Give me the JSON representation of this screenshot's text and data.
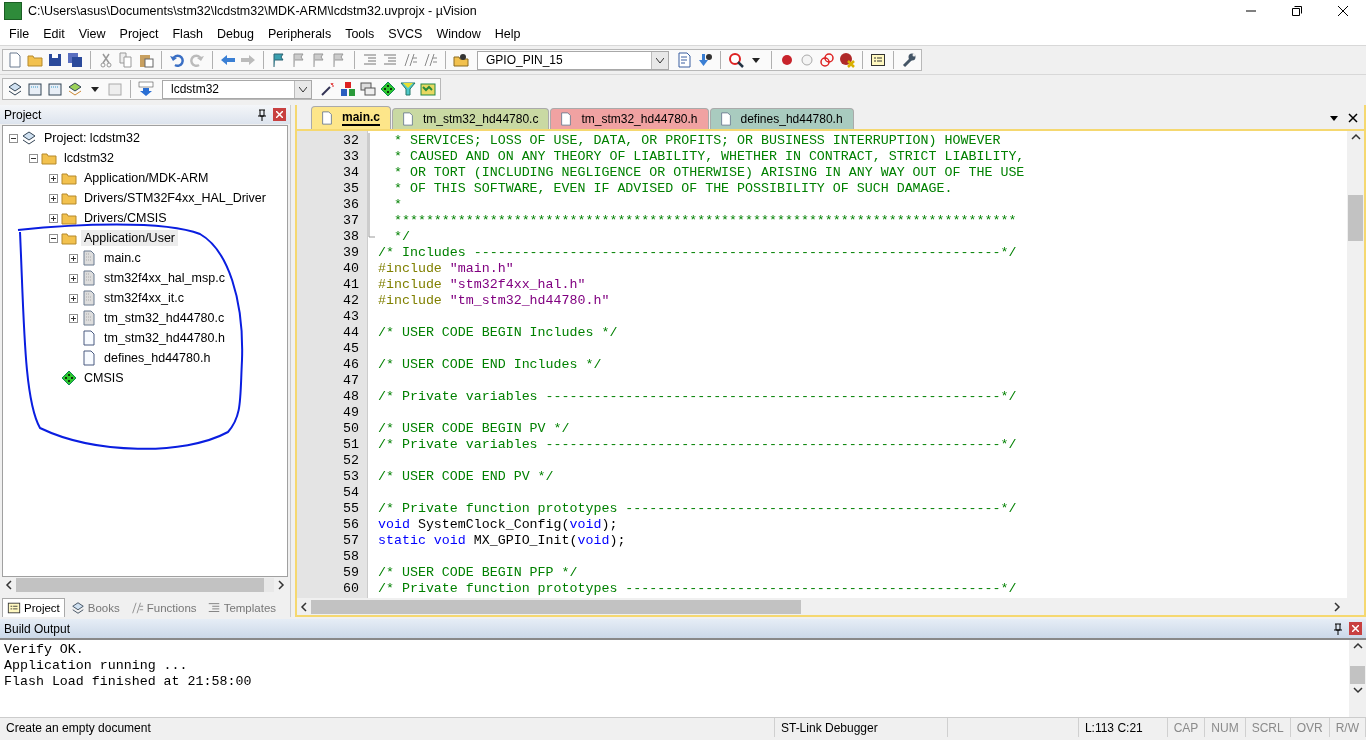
{
  "window": {
    "title": "C:\\Users\\asus\\Documents\\stm32\\lcdstm32\\MDK-ARM\\lcdstm32.uvprojx - µVision"
  },
  "menu": [
    "File",
    "Edit",
    "View",
    "Project",
    "Flash",
    "Debug",
    "Peripherals",
    "Tools",
    "SVCS",
    "Window",
    "Help"
  ],
  "toolbar": {
    "find_value": "GPIO_PIN_15",
    "target_value": "lcdstm32"
  },
  "project_panel": {
    "title": "Project",
    "tree": [
      {
        "label": "Project: lcdstm32",
        "kind": "project",
        "expanded": true,
        "selected": false,
        "children": [
          {
            "label": "lcdstm32",
            "kind": "target",
            "expanded": true,
            "selected": false,
            "children": [
              {
                "label": "Application/MDK-ARM",
                "kind": "folder",
                "expanded": false,
                "selected": false
              },
              {
                "label": "Drivers/STM32F4xx_HAL_Driver",
                "kind": "folder",
                "expanded": false,
                "selected": false
              },
              {
                "label": "Drivers/CMSIS",
                "kind": "folder",
                "expanded": false,
                "selected": false
              },
              {
                "label": "Application/User",
                "kind": "folder",
                "expanded": true,
                "selected": true,
                "children": [
                  {
                    "label": "main.c",
                    "kind": "source",
                    "expanded": false,
                    "selected": false
                  },
                  {
                    "label": "stm32f4xx_hal_msp.c",
                    "kind": "source",
                    "expanded": false,
                    "selected": false
                  },
                  {
                    "label": "stm32f4xx_it.c",
                    "kind": "source",
                    "expanded": false,
                    "selected": false
                  },
                  {
                    "label": "tm_stm32_hd44780.c",
                    "kind": "source",
                    "expanded": false,
                    "selected": false
                  },
                  {
                    "label": "tm_stm32_hd44780.h",
                    "kind": "header",
                    "selected": false
                  },
                  {
                    "label": "defines_hd44780.h",
                    "kind": "header",
                    "selected": false
                  }
                ]
              },
              {
                "label": "CMSIS",
                "kind": "component",
                "selected": false
              }
            ]
          }
        ]
      }
    ],
    "tabs": [
      {
        "label": "Project",
        "selected": true
      },
      {
        "label": "Books",
        "selected": false
      },
      {
        "label": "Functions",
        "selected": false
      },
      {
        "label": "Templates",
        "selected": false
      }
    ]
  },
  "editor": {
    "tabs": [
      {
        "label": "main.c",
        "selected": true,
        "color": "#fde68a"
      },
      {
        "label": "tm_stm32_hd44780.c",
        "selected": false,
        "color": "#c9d9a3"
      },
      {
        "label": "tm_stm32_hd44780.h",
        "selected": false,
        "color": "#f0a2a2"
      },
      {
        "label": "defines_hd44780.h",
        "selected": false,
        "color": "#a9cbbf"
      }
    ],
    "lines": [
      {
        "number": "32",
        "parts": [
          {
            "kind": "comment",
            "text": "  * SERVICES; LOSS OF USE, DATA, OR PROFITS; OR BUSINESS INTERRUPTION) HOWEVER"
          }
        ]
      },
      {
        "number": "33",
        "parts": [
          {
            "kind": "comment",
            "text": "  * CAUSED AND ON ANY THEORY OF LIABILITY, WHETHER IN CONTRACT, STRICT LIABILITY,"
          }
        ]
      },
      {
        "number": "34",
        "parts": [
          {
            "kind": "comment",
            "text": "  * OR TORT (INCLUDING NEGLIGENCE OR OTHERWISE) ARISING IN ANY WAY OUT OF THE USE"
          }
        ]
      },
      {
        "number": "35",
        "parts": [
          {
            "kind": "comment",
            "text": "  * OF THIS SOFTWARE, EVEN IF ADVISED OF THE POSSIBILITY OF SUCH DAMAGE."
          }
        ]
      },
      {
        "number": "36",
        "parts": [
          {
            "kind": "comment",
            "text": "  *"
          }
        ]
      },
      {
        "number": "37",
        "parts": [
          {
            "kind": "comment",
            "text": "  ******************************************************************************"
          }
        ]
      },
      {
        "number": "38",
        "parts": [
          {
            "kind": "comment",
            "text": "  */"
          }
        ]
      },
      {
        "number": "39",
        "parts": [
          {
            "kind": "comment",
            "text": "/* Includes ------------------------------------------------------------------*/"
          }
        ]
      },
      {
        "number": "40",
        "parts": [
          {
            "kind": "preprocessor",
            "text": "#include "
          },
          {
            "kind": "string",
            "text": "\"main.h\""
          }
        ]
      },
      {
        "number": "41",
        "parts": [
          {
            "kind": "preprocessor",
            "text": "#include "
          },
          {
            "kind": "string",
            "text": "\"stm32f4xx_hal.h\""
          }
        ]
      },
      {
        "number": "42",
        "parts": [
          {
            "kind": "preprocessor",
            "text": "#include "
          },
          {
            "kind": "string",
            "text": "\"tm_stm32_hd44780.h\""
          }
        ]
      },
      {
        "number": "43"
      },
      {
        "number": "44",
        "parts": [
          {
            "kind": "comment",
            "text": "/* USER CODE BEGIN Includes */"
          }
        ]
      },
      {
        "number": "45"
      },
      {
        "number": "46",
        "parts": [
          {
            "kind": "comment",
            "text": "/* USER CODE END Includes */"
          }
        ]
      },
      {
        "number": "47"
      },
      {
        "number": "48",
        "parts": [
          {
            "kind": "comment",
            "text": "/* Private variables ---------------------------------------------------------*/"
          }
        ]
      },
      {
        "number": "49"
      },
      {
        "number": "50",
        "parts": [
          {
            "kind": "comment",
            "text": "/* USER CODE BEGIN PV */"
          }
        ]
      },
      {
        "number": "51",
        "parts": [
          {
            "kind": "comment",
            "text": "/* Private variables ---------------------------------------------------------*/"
          }
        ]
      },
      {
        "number": "52"
      },
      {
        "number": "53",
        "parts": [
          {
            "kind": "comment",
            "text": "/* USER CODE END PV */"
          }
        ]
      },
      {
        "number": "54"
      },
      {
        "number": "55",
        "parts": [
          {
            "kind": "comment",
            "text": "/* Private function prototypes -----------------------------------------------*/"
          }
        ]
      },
      {
        "number": "56",
        "parts": [
          {
            "kind": "keyword",
            "text": "void"
          },
          {
            "kind": "plain",
            "text": " SystemClock_Config("
          },
          {
            "kind": "keyword",
            "text": "void"
          },
          {
            "kind": "plain",
            "text": ");"
          }
        ]
      },
      {
        "number": "57",
        "parts": [
          {
            "kind": "keyword",
            "text": "static void"
          },
          {
            "kind": "plain",
            "text": " MX_GPIO_Init("
          },
          {
            "kind": "keyword",
            "text": "void"
          },
          {
            "kind": "plain",
            "text": ");"
          }
        ]
      },
      {
        "number": "58"
      },
      {
        "number": "59",
        "parts": [
          {
            "kind": "comment",
            "text": "/* USER CODE BEGIN PFP */"
          }
        ]
      },
      {
        "number": "60",
        "parts": [
          {
            "kind": "comment",
            "text": "/* Private function prototypes -----------------------------------------------*/"
          }
        ]
      }
    ]
  },
  "build_output": {
    "title": "Build Output",
    "lines": [
      "Verify OK.",
      "Application running ...",
      "Flash Load finished at 21:58:00"
    ]
  },
  "status_bar": {
    "message": "Create an empty document",
    "debugger": "ST-Link Debugger",
    "position": "L:113 C:21",
    "indicators": [
      {
        "label": "CAP",
        "on": false
      },
      {
        "label": "NUM",
        "on": false
      },
      {
        "label": "SCRL",
        "on": false
      },
      {
        "label": "OVR",
        "on": false
      },
      {
        "label": "R/W",
        "on": false
      }
    ]
  }
}
